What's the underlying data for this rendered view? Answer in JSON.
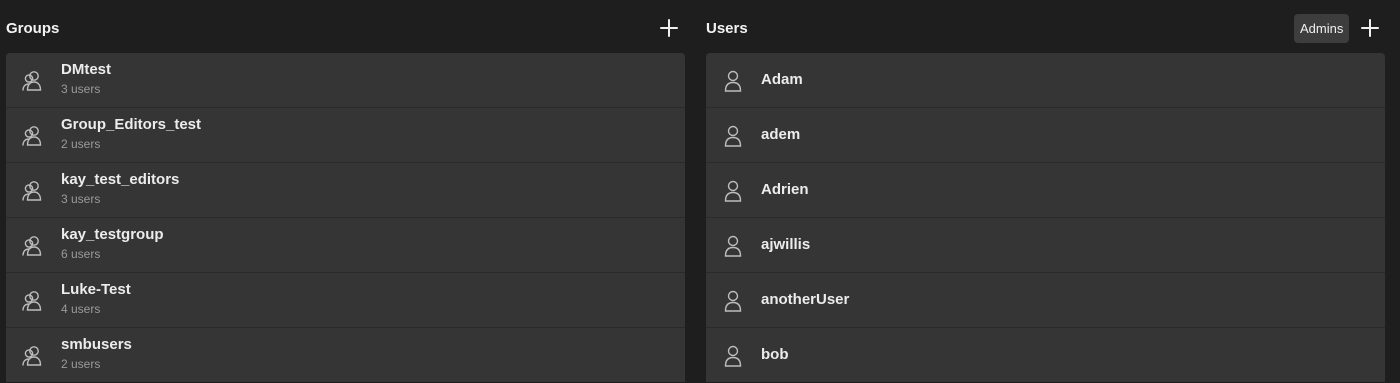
{
  "groups": {
    "title": "Groups",
    "items": [
      {
        "name": "DMtest",
        "count": "3 users"
      },
      {
        "name": "Group_Editors_test",
        "count": "2 users"
      },
      {
        "name": "kay_test_editors",
        "count": "3 users"
      },
      {
        "name": "kay_testgroup",
        "count": "6 users"
      },
      {
        "name": "Luke-Test",
        "count": "4 users"
      },
      {
        "name": "smbusers",
        "count": "2 users"
      }
    ]
  },
  "users": {
    "title": "Users",
    "admins_label": "Admins",
    "items": [
      {
        "name": "Adam"
      },
      {
        "name": "adem"
      },
      {
        "name": "Adrien"
      },
      {
        "name": "ajwillis"
      },
      {
        "name": "anotherUser"
      },
      {
        "name": "bob"
      }
    ]
  },
  "icons": {
    "group": "group-icon",
    "user": "user-icon",
    "add": "plus-icon"
  }
}
